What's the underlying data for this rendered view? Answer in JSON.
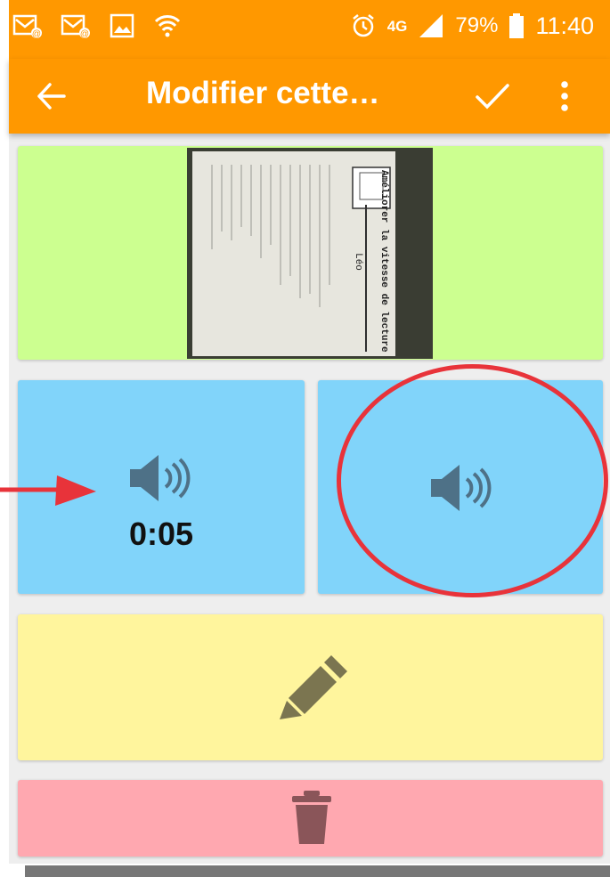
{
  "status_bar": {
    "network": "4G",
    "battery": "79%",
    "time": "11:40"
  },
  "app_bar": {
    "title": "Modifier cette…"
  },
  "icons": {
    "back": "arrow-left-icon",
    "confirm": "check-icon",
    "menu": "more-vert-icon",
    "audio": "speaker-icon",
    "edit": "pencil-icon",
    "delete": "trash-icon"
  },
  "photo_card": {
    "document_title": "Améliorer la vitesse de lecture",
    "document_author": "Léo"
  },
  "audio_cards": [
    {
      "duration": "0:05"
    },
    {
      "duration": ""
    }
  ],
  "colors": {
    "app_bar": "#ff9800",
    "photo_card": "#ccff90",
    "audio_card": "#81d4fa",
    "edit_card": "#fff59d",
    "delete_card": "#ffa8b0",
    "annotation": "#e8333a"
  }
}
